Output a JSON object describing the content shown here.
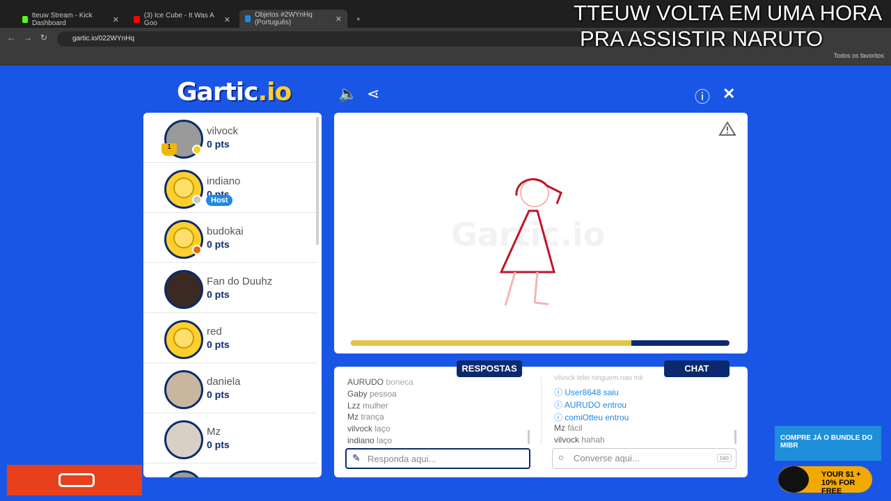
{
  "browser": {
    "tabs": [
      {
        "label": "tteuw Stream - Kick Dashboard",
        "color": "#53fc18"
      },
      {
        "label": "(3) Ice Cube - It Was A Goo",
        "color": "#ff0000"
      },
      {
        "label": "Objetos #2WYnHq (Português)",
        "color": "#1e88e5"
      }
    ],
    "url": "gartic.io/022WYnHq",
    "bookmarks_label": "Todos os favoritos"
  },
  "overlay": {
    "line1": "TTEUW VOLTA EM UMA HORA",
    "line2": "PRA ASSISTIR NARUTO"
  },
  "game": {
    "logo_text": "Gartic",
    "logo_suffix": ".io",
    "players": [
      {
        "name": "vilvock",
        "pts": "0 pts",
        "avatar": "gray",
        "dot": "#f2d21e",
        "trophy": "1"
      },
      {
        "name": "indiano",
        "pts": "0 pts",
        "avatar": "yellow",
        "dot": "#c8c8c8",
        "badge": "Host"
      },
      {
        "name": "budokai",
        "pts": "0 pts",
        "avatar": "yellow",
        "dot": "#e06a00"
      },
      {
        "name": "Fan do Duuhz",
        "pts": "0 pts",
        "avatar": "dark"
      },
      {
        "name": "red",
        "pts": "0 pts",
        "avatar": "yellow"
      },
      {
        "name": "daniela",
        "pts": "0 pts",
        "avatar": "light"
      },
      {
        "name": "Mz",
        "pts": "0 pts",
        "avatar": "photo"
      }
    ],
    "watermark": "Gartic.io",
    "timer_fraction": 0.74,
    "answers_tab": "RESPOSTAS",
    "chat_tab": "CHAT",
    "answers": [
      {
        "user": "AURUDO",
        "text": "boneca"
      },
      {
        "user": "Gaby",
        "text": "pessoa"
      },
      {
        "user": "Lzz",
        "text": "mulher"
      },
      {
        "user": "Mz",
        "text": "trança"
      },
      {
        "user": "vilvock",
        "text": "laço"
      },
      {
        "user": "indiano",
        "text": "laço"
      }
    ],
    "chat": [
      {
        "user": "vilvock",
        "text": "telei ninguem nao mk",
        "system": false
      },
      {
        "user": "User8648",
        "text": "saiu",
        "system": true
      },
      {
        "user": "AURUDO",
        "text": "entrou",
        "system": true
      },
      {
        "user": "comiOtteu",
        "text": "entrou",
        "system": true
      },
      {
        "user": "Mz",
        "text": "fácil",
        "system": false
      },
      {
        "user": "vilvock",
        "text": "hahah",
        "system": false
      }
    ],
    "answer_placeholder": "Responda aqui...",
    "chat_placeholder": "Converse aqui...",
    "tab_key": "tab"
  },
  "ads": {
    "mibr_text": "COMPRE JÁ O BUNDLE DO MIBR",
    "mibr_cta": "YOUR $1 + 10% FOR FREE"
  }
}
